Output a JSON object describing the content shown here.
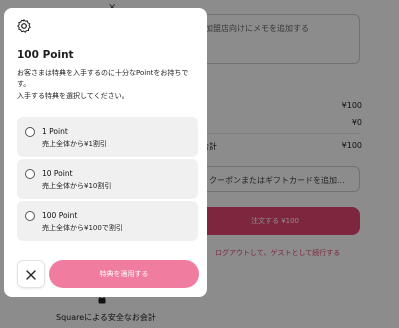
{
  "background": {
    "memo_placeholder": "加盟店向けにメモを追加する",
    "close_mark": "×",
    "subtotal_value": "¥100",
    "discount_value": "¥0",
    "total_label": "合計",
    "total_value": "¥100",
    "coupon_placeholder": "クーポンまたはギフトカードを追加...",
    "order_button": "注文する ¥100",
    "logout_link": "ログアウトして、ゲストとして続行する",
    "secure_footer": "Squareによる安全なお会計"
  },
  "modal": {
    "title": "100 Point",
    "description": "お客さまは特典を入手するのに十分なPointをお持ちです。",
    "instruction": "入手する特典を選択してください。",
    "rewards": [
      {
        "title": "1 Point",
        "subtitle": "売上全体から¥1割引"
      },
      {
        "title": "10 Point",
        "subtitle": "売上全体から¥10割引"
      },
      {
        "title": "100 Point",
        "subtitle": "売上全体から¥100で割引"
      }
    ],
    "apply_button": "特典を適用する"
  },
  "colors": {
    "accent": "#e34672",
    "apply_disabled": "#f07da0",
    "option_bg": "#f0f0f0"
  },
  "icons": {
    "logo": "reward-badge-icon",
    "close": "close-icon",
    "lock": "lock-icon"
  }
}
